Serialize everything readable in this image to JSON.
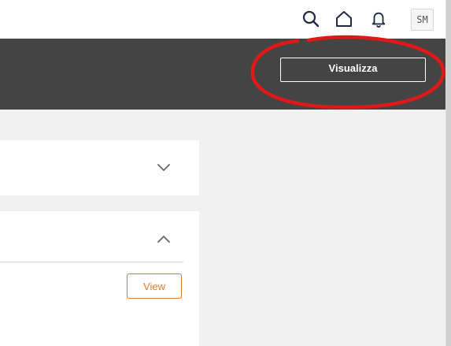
{
  "header": {
    "icons": [
      "search-icon",
      "home-icon",
      "bell-icon"
    ],
    "avatar_initials": "SM"
  },
  "banner": {
    "visualizza_label": "Visualizza"
  },
  "cards": [
    {
      "state": "collapsed",
      "chevron": "chevron-down-icon"
    },
    {
      "state": "expanded",
      "chevron": "chevron-up-icon",
      "view_label": "View"
    }
  ],
  "colors": {
    "banner_bg": "#444444",
    "accent": "#e07a2e",
    "annotation": "#e01818",
    "icon": "#1f2a44"
  }
}
